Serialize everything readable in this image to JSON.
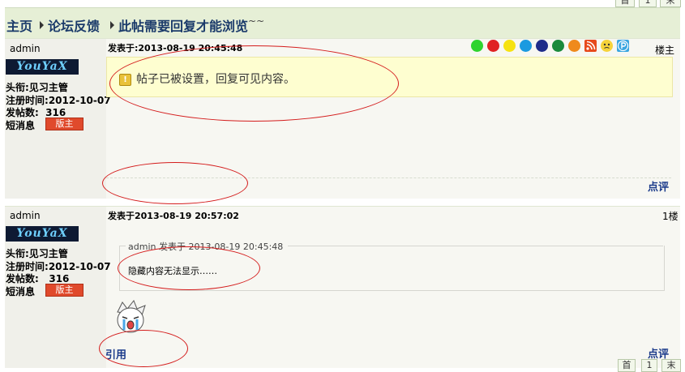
{
  "pager_top": {
    "first": "首",
    "page": "1",
    "last": "末"
  },
  "breadcrumb": {
    "home": "主页",
    "forum": "论坛反馈",
    "thread": "此帖需要回复才能浏览",
    "thread_suffix": "~~"
  },
  "posts": [
    {
      "username": "admin",
      "logo_text": "YouYaX",
      "title_label": "头衔:",
      "title_value": "见习主管",
      "reg_label": "注册时间:",
      "reg_value": "2012-10-07",
      "count_label": "发帖数:",
      "count_value": "316",
      "msg_label": "短消息",
      "badge": "版主",
      "time": "发表于:2013-08-19 20:45:48",
      "floor": "楼主",
      "notice": "帖子已被设置，回复可见内容。",
      "warn_glyph": "!",
      "rate": "点评"
    },
    {
      "username": "admin",
      "logo_text": "YouYaX",
      "title_label": "头衔:",
      "title_value": "见习主管",
      "reg_label": "注册时间:",
      "reg_value": "2012-10-07",
      "count_label": "发帖数:",
      "count_value": "316",
      "msg_label": "短消息",
      "badge": "版主",
      "time": "发表于2013-08-19 20:57:02",
      "floor": "1楼",
      "quote_head": "admin 发表于 2013-08-19 20:45:48",
      "quote_text": "隐藏内容无法显示……",
      "reply": "引用",
      "rate": "点评"
    }
  ],
  "color_dots": [
    "#2ed32e",
    "#e02222",
    "#f6e210",
    "#1b9ae0",
    "#1f2c8a",
    "#1a8a3c",
    "#ef8a1c"
  ],
  "toolbar_icons": [
    "rss-icon",
    "emoticon-icon",
    "p-icon"
  ],
  "pager_bottom": {
    "first": "首",
    "page": "1",
    "last": "末"
  }
}
